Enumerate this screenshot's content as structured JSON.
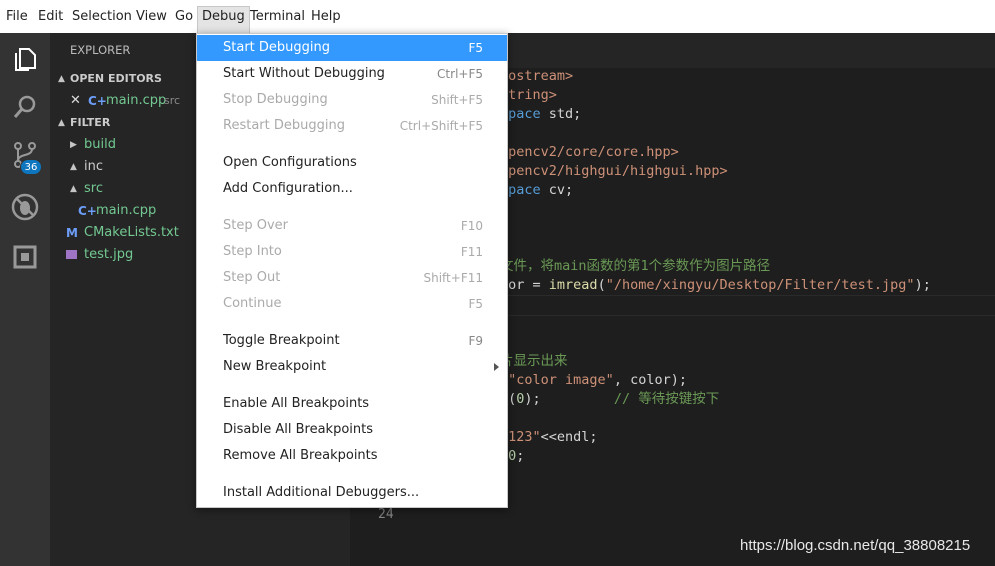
{
  "menubar": {
    "items": [
      "File",
      "Edit",
      "Selection",
      "View",
      "Go",
      "Debug",
      "Terminal",
      "Help"
    ],
    "active": "Debug"
  },
  "activity": {
    "badge": "36",
    "icons": [
      "files-icon",
      "search-icon",
      "source-control-icon",
      "debug-icon",
      "extensions-icon"
    ]
  },
  "sidebar": {
    "title": "EXPLORER",
    "open_editors_label": "OPEN EDITORS",
    "open_editor_file": "main.cpp",
    "open_editor_dir": "src",
    "folder_label": "FILTER",
    "tree": [
      {
        "name": "build",
        "kind": "folder-collapsed"
      },
      {
        "name": "inc",
        "kind": "folder-expanded"
      },
      {
        "name": "src",
        "kind": "folder-expanded"
      },
      {
        "name": "main.cpp",
        "kind": "cpp-file"
      },
      {
        "name": "CMakeLists.txt",
        "kind": "cmake-file"
      },
      {
        "name": "test.jpg",
        "kind": "image-file"
      }
    ]
  },
  "editor": {
    "line_number": "24",
    "lines": [
      {
        "parts": [
          {
            "t": "iostream>",
            "c": "str"
          }
        ]
      },
      {
        "parts": [
          {
            "t": "string>",
            "c": "str"
          }
        ]
      },
      {
        "parts": [
          {
            "t": "space ",
            "c": "kw"
          },
          {
            "t": "std;",
            "c": "plain"
          }
        ]
      },
      {
        "parts": []
      },
      {
        "parts": [
          {
            "t": "opencv2/core/core.hpp>",
            "c": "str"
          }
        ]
      },
      {
        "parts": [
          {
            "t": "opencv2/highgui/highgui.hpp>",
            "c": "str"
          }
        ]
      },
      {
        "parts": [
          {
            "t": "space ",
            "c": "kw"
          },
          {
            "t": "cv;",
            "c": "plain"
          }
        ]
      },
      {
        "parts": []
      },
      {
        "parts": []
      },
      {
        "parts": []
      },
      {
        "parts": [
          {
            "t": "文件，将main函数的第1个参数作为图片路径",
            "c": "cm"
          }
        ]
      },
      {
        "parts": [
          {
            "t": "lor = ",
            "c": "plain"
          },
          {
            "t": "imread",
            "c": "fn"
          },
          {
            "t": "(",
            "c": "plain"
          },
          {
            "t": "\"/home/xingyu/Desktop/Filter/test.jpg\"",
            "c": "str"
          },
          {
            "t": ");",
            "c": "plain"
          }
        ]
      },
      {
        "parts": []
      },
      {
        "parts": []
      },
      {
        "parts": []
      },
      {
        "parts": [
          {
            "t": "片显示出来",
            "c": "cm"
          }
        ]
      },
      {
        "parts": [
          {
            "t": "(",
            "c": "plain"
          },
          {
            "t": "\"color image\"",
            "c": "str"
          },
          {
            "t": ", color);",
            "c": "plain"
          }
        ]
      },
      {
        "parts": [
          {
            "t": "y(",
            "c": "plain"
          },
          {
            "t": "0",
            "c": "num"
          },
          {
            "t": ");         ",
            "c": "plain"
          },
          {
            "t": "// 等待按键按下",
            "c": "cm"
          }
        ]
      },
      {
        "parts": []
      },
      {
        "parts": [
          {
            "t": "\"123\"",
            "c": "str"
          },
          {
            "t": "<<endl;",
            "c": "plain"
          }
        ]
      },
      {
        "parts": [
          {
            "t": " ",
            "c": "plain"
          },
          {
            "t": "0",
            "c": "num"
          },
          {
            "t": ";",
            "c": "plain"
          }
        ]
      }
    ]
  },
  "debug_menu": {
    "items": [
      {
        "label": "Start Debugging",
        "shortcut": "F5",
        "state": "selected"
      },
      {
        "label": "Start Without Debugging",
        "shortcut": "Ctrl+F5",
        "state": "enabled"
      },
      {
        "label": "Stop Debugging",
        "shortcut": "Shift+F5",
        "state": "disabled"
      },
      {
        "label": "Restart Debugging",
        "shortcut": "Ctrl+Shift+F5",
        "state": "disabled"
      },
      {
        "label": "Open Configurations",
        "shortcut": "",
        "state": "enabled"
      },
      {
        "label": "Add Configuration...",
        "shortcut": "",
        "state": "enabled"
      },
      {
        "label": "Step Over",
        "shortcut": "F10",
        "state": "disabled"
      },
      {
        "label": "Step Into",
        "shortcut": "F11",
        "state": "disabled"
      },
      {
        "label": "Step Out",
        "shortcut": "Shift+F11",
        "state": "disabled"
      },
      {
        "label": "Continue",
        "shortcut": "F5",
        "state": "disabled"
      },
      {
        "label": "Toggle Breakpoint",
        "shortcut": "F9",
        "state": "enabled"
      },
      {
        "label": "New Breakpoint",
        "shortcut": "",
        "state": "submenu"
      },
      {
        "label": "Enable All Breakpoints",
        "shortcut": "",
        "state": "enabled"
      },
      {
        "label": "Disable All Breakpoints",
        "shortcut": "",
        "state": "enabled"
      },
      {
        "label": "Remove All Breakpoints",
        "shortcut": "",
        "state": "enabled"
      },
      {
        "label": "Install Additional Debuggers...",
        "shortcut": "",
        "state": "enabled"
      }
    ]
  },
  "watermark": "https://blog.csdn.net/qq_38808215",
  "colors": {
    "menu_selection": "#3399ff",
    "activity_bar": "#333333",
    "sidebar": "#252526",
    "editor_bg": "#1e1e1e",
    "badge": "#0e76bf",
    "git_untracked": "#73c991"
  }
}
